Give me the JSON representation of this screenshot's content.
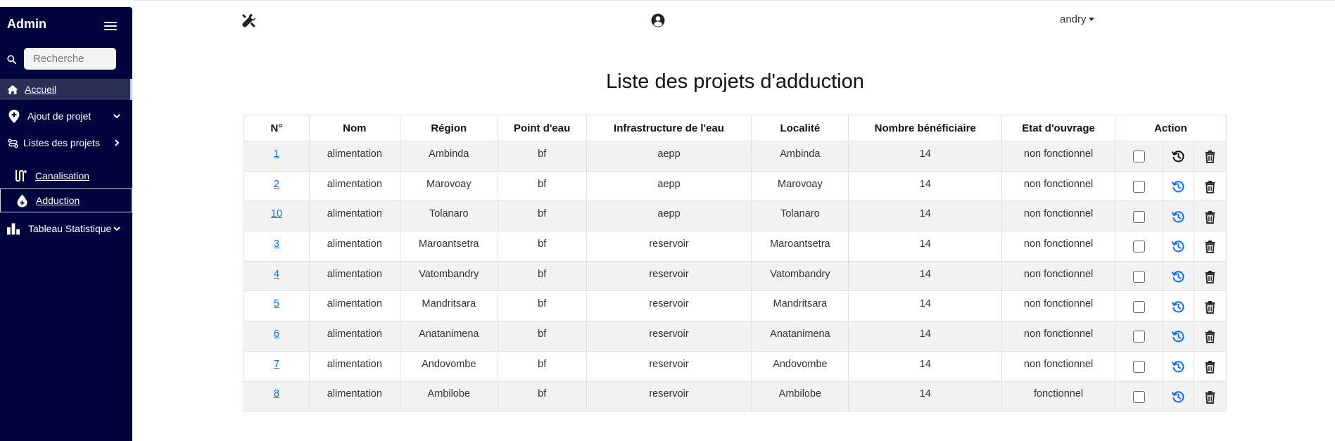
{
  "sidebar": {
    "brand": "Admin",
    "search": {
      "placeholder": "Recherche",
      "value": ""
    },
    "items": [
      {
        "label": "Accueil",
        "icon": "home-icon"
      },
      {
        "label": "Ajout de projet",
        "icon": "map-pin-plus-icon"
      },
      {
        "label": "Listes des projets",
        "icon": "route-list-icon"
      },
      {
        "label": "Canalisation",
        "icon": "pipe-route-icon"
      },
      {
        "label": "Adduction",
        "icon": "water-drop-icon"
      },
      {
        "label": "Tableau Statistique",
        "icon": "bar-chart-icon"
      }
    ],
    "bg_color": "#00063d"
  },
  "topbar": {
    "tools_icon": "tools-icon",
    "user_icon": "user-circle-icon",
    "username": "andry"
  },
  "main": {
    "title": "Liste des projets d'adduction",
    "table": {
      "headers": [
        "N°",
        "Nom",
        "Région",
        "Point d'eau",
        "Infrastructure de l'eau",
        "Localité",
        "Nombre bénéficiaire",
        "Etat d'ouvrage",
        "Action"
      ],
      "rows": [
        {
          "num": "1",
          "nom": "alimentation",
          "region": "Ambinda",
          "point": "bf",
          "infra": "aepp",
          "localite": "Ambinda",
          "nombre": "14",
          "etat": "non fonctionnel"
        },
        {
          "num": "2",
          "nom": "alimentation",
          "region": "Marovoay",
          "point": "bf",
          "infra": "aepp",
          "localite": "Marovoay",
          "nombre": "14",
          "etat": "non fonctionnel"
        },
        {
          "num": "10",
          "nom": "alimentation",
          "region": "Tolanaro",
          "point": "bf",
          "infra": "aepp",
          "localite": "Tolanaro",
          "nombre": "14",
          "etat": "non fonctionnel"
        },
        {
          "num": "3",
          "nom": "alimentation",
          "region": "Maroantsetra",
          "point": "bf",
          "infra": "reservoir",
          "localite": "Maroantsetra",
          "nombre": "14",
          "etat": "non fonctionnel"
        },
        {
          "num": "4",
          "nom": "alimentation",
          "region": "Vatombandry",
          "point": "bf",
          "infra": "reservoir",
          "localite": "Vatombandry",
          "nombre": "14",
          "etat": "non fonctionnel"
        },
        {
          "num": "5",
          "nom": "alimentation",
          "region": "Mandritsara",
          "point": "bf",
          "infra": "reservoir",
          "localite": "Mandritsara",
          "nombre": "14",
          "etat": "non fonctionnel"
        },
        {
          "num": "6",
          "nom": "alimentation",
          "region": "Anatanimena",
          "point": "bf",
          "infra": "reservoir",
          "localite": "Anatanimena",
          "nombre": "14",
          "etat": "non fonctionnel"
        },
        {
          "num": "7",
          "nom": "alimentation",
          "region": "Andovombe",
          "point": "bf",
          "infra": "reservoir",
          "localite": "Andovombe",
          "nombre": "14",
          "etat": "non fonctionnel"
        },
        {
          "num": "8",
          "nom": "alimentation",
          "region": "Ambilobe",
          "point": "bf",
          "infra": "reservoir",
          "localite": "Ambilobe",
          "nombre": "14",
          "etat": "fonctionnel"
        }
      ],
      "action_icons": [
        "checkbox",
        "history-icon",
        "trash-icon"
      ],
      "link_color": "#0d6efd",
      "history_color_first": "#111111",
      "history_color": "#0d6efd"
    }
  }
}
